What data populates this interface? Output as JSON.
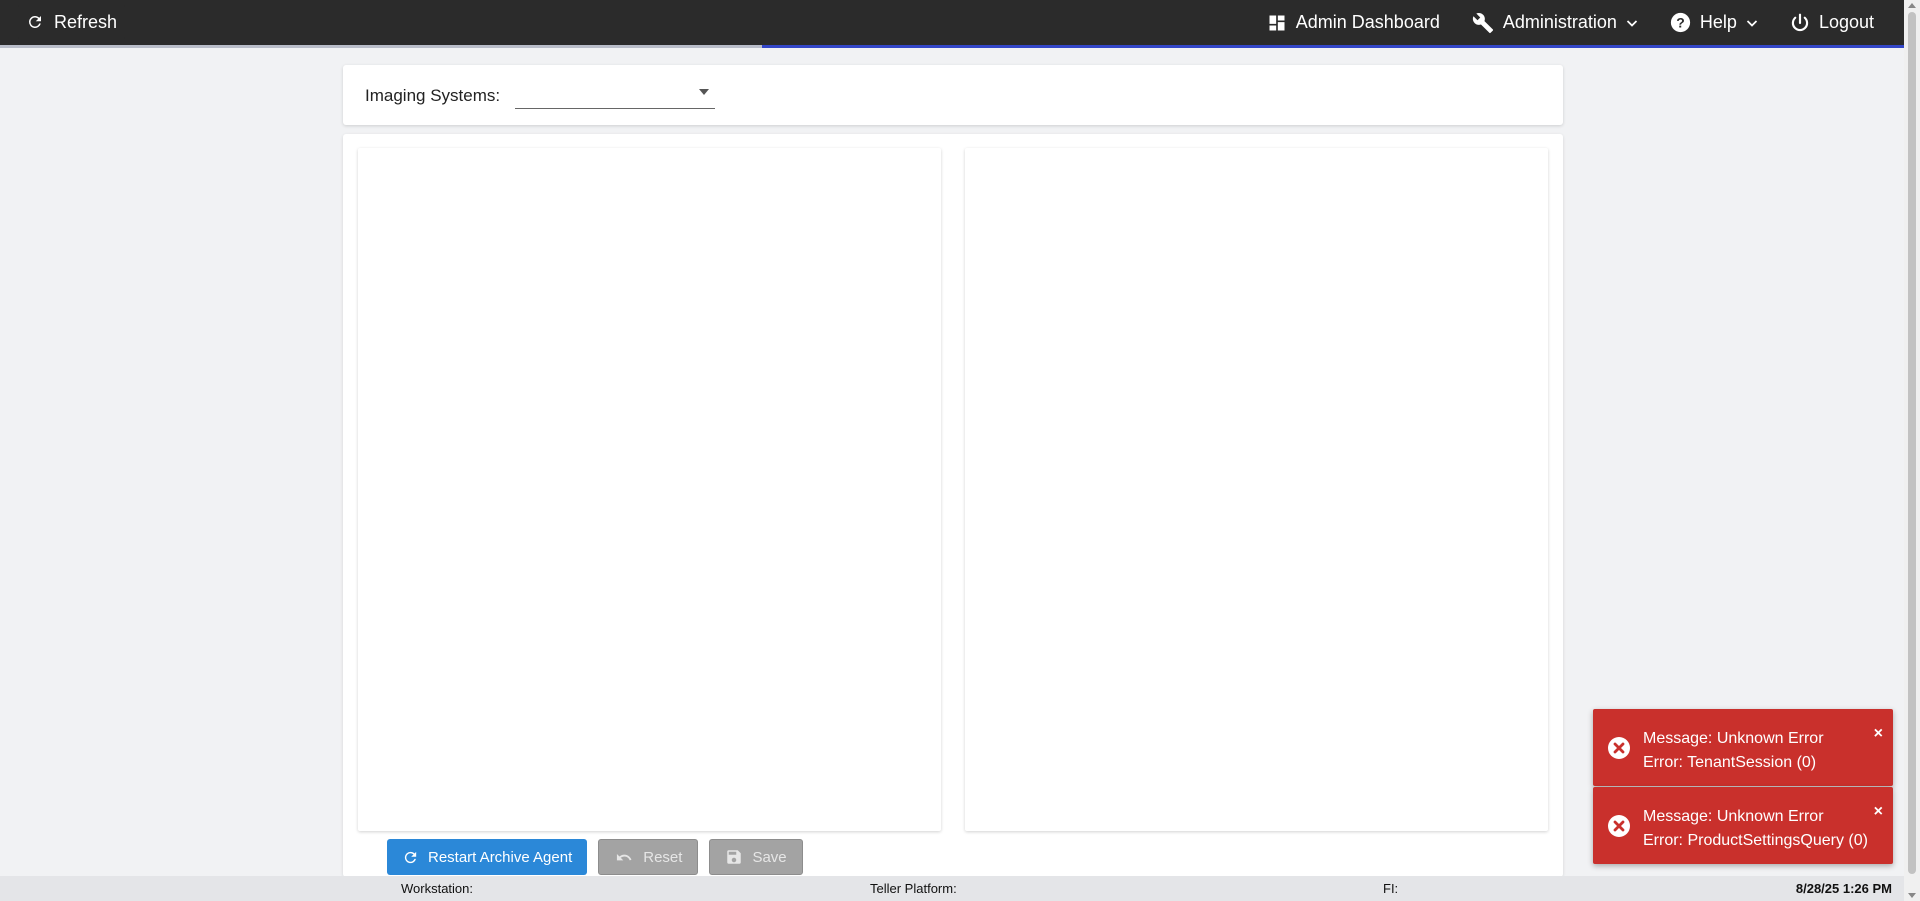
{
  "header": {
    "refresh_label": "Refresh",
    "nav": {
      "admin_dashboard": "Admin Dashboard",
      "administration": "Administration",
      "help": "Help",
      "logout": "Logout"
    }
  },
  "progress": {
    "fraction": 0.6
  },
  "filter": {
    "label": "Imaging Systems:",
    "selected_value": ""
  },
  "actions": {
    "restart_label": "Restart Archive Agent",
    "reset_label": "Reset",
    "save_label": "Save"
  },
  "statusbar": {
    "workstation": "Workstation:",
    "teller_platform": "Teller Platform:",
    "fi": "FI:",
    "datetime": "8/28/25 1:26 PM"
  },
  "toasts": [
    {
      "message": "Message: Unknown Error",
      "error": "Error: TenantSession (0)",
      "close": "×"
    },
    {
      "message": "Message: Unknown Error",
      "error": "Error: ProductSettingsQuery (0)",
      "close": "×"
    }
  ],
  "colors": {
    "topbar": "#2b2b2b",
    "primary": "#2b88d8",
    "error": "#c9302c",
    "progress": "#3346c8"
  }
}
